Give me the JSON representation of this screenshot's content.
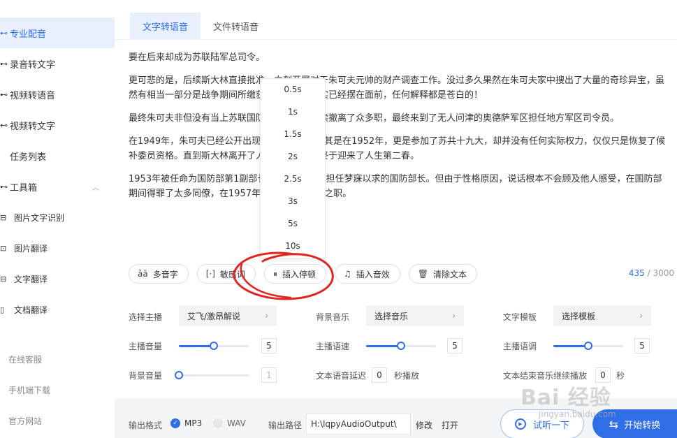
{
  "sidebar": {
    "items": [
      {
        "label": "专业配音"
      },
      {
        "label": "录音转文字"
      },
      {
        "label": "视频转语音"
      },
      {
        "label": "视频转文字"
      },
      {
        "label": "任务列表"
      },
      {
        "label": "工具箱"
      },
      {
        "label": "图片文字识别"
      },
      {
        "label": "图片翻译"
      },
      {
        "label": "文字翻译"
      },
      {
        "label": "文档翻译"
      }
    ],
    "footer": [
      "在线客服",
      "手机端下载",
      "官方网站"
    ]
  },
  "tabs": [
    {
      "label": "文字转语音"
    },
    {
      "label": "文件转语音"
    }
  ],
  "text": {
    "p1": "要在后来却成为苏联陆军总司令。",
    "p2": "更可悲的是，后续斯大林直接批准，立刻开展对于朱可夫元帅的财产调查工作。没过多久果然在朱可夫家中搜出了大量的奇珍异宝，虽然有相当一部分是战争期间所缴获战利品，可事实已经摆在面前，任何解释都是苍白的！",
    "p3": "最终朱可夫非但没有当上苏联国防部长，还被陆续撤离了众多职，最终来到了无人问津的奥德萨军区担任地方军区司令员。",
    "p4": "在1949年，朱可夫已经公开出现在了报纸上。尤其是在1952年，更是参加了苏共十九大，却并没有任何实际权力，仅仅只是恢复了候补委员资格。直到斯大林离开了人世，朱可夫也终于迎来了人生第二春。",
    "p5": "1953年被任命为国防部第1副部长，1955年终于担任梦寐以求的国防部长。但由于性格原因，说话根本不会顾及他人感受，在国防部期间得罪了太多同僚，在1957年被免去国防部长之职。"
  },
  "toolbar": {
    "polyphone": "多音字",
    "sensitive": "敏感词",
    "insert_pause": "插入停顿",
    "insert_sound": "插入音效",
    "clear_text": "清除文本"
  },
  "counter": {
    "current": "435",
    "sep": " / ",
    "max": "3000"
  },
  "pause_options": [
    "0.5s",
    "1s",
    "1.5s",
    "2s",
    "2.5s",
    "3s",
    "5s",
    "10s"
  ],
  "settings": {
    "anchor_label": "选择主播",
    "anchor_value": "艾飞/激昂解说",
    "bgm_label": "背景音乐",
    "bgm_value": "选择音乐",
    "template_label": "文字模板",
    "template_value": "选择模板",
    "anchor_volume_label": "主播音量",
    "anchor_volume": "5",
    "anchor_volume_level": 0.5,
    "anchor_speed_label": "主播语速",
    "anchor_speed": "5",
    "anchor_speed_level": 0.5,
    "anchor_pitch_label": "主播语调",
    "anchor_pitch": "5",
    "anchor_pitch_level": 0.5,
    "bg_volume_label": "背景音量",
    "bg_volume": "1",
    "bg_volume_level": 0.0,
    "delay_label": "文本语音延迟",
    "delay_value": "0",
    "delay_unit": "秒播放",
    "tail_label": "文本结束音乐继续播放",
    "tail_value": "0",
    "tail_unit": "秒"
  },
  "output": {
    "format_label": "输出格式",
    "mp3": "MP3",
    "wav": "WAV",
    "path_label": "输出路径",
    "path_value": "H:\\lqpyAudioOutput\\",
    "modify": "修改",
    "open": "打开"
  },
  "buttons": {
    "listen": "试听一下",
    "start": "开始转换"
  },
  "watermark": {
    "logo": "Bai 经验",
    "url": "jingyan.baidu.com"
  },
  "colors": {
    "accent": "#2f6ee6",
    "annotation": "#e0261f"
  }
}
